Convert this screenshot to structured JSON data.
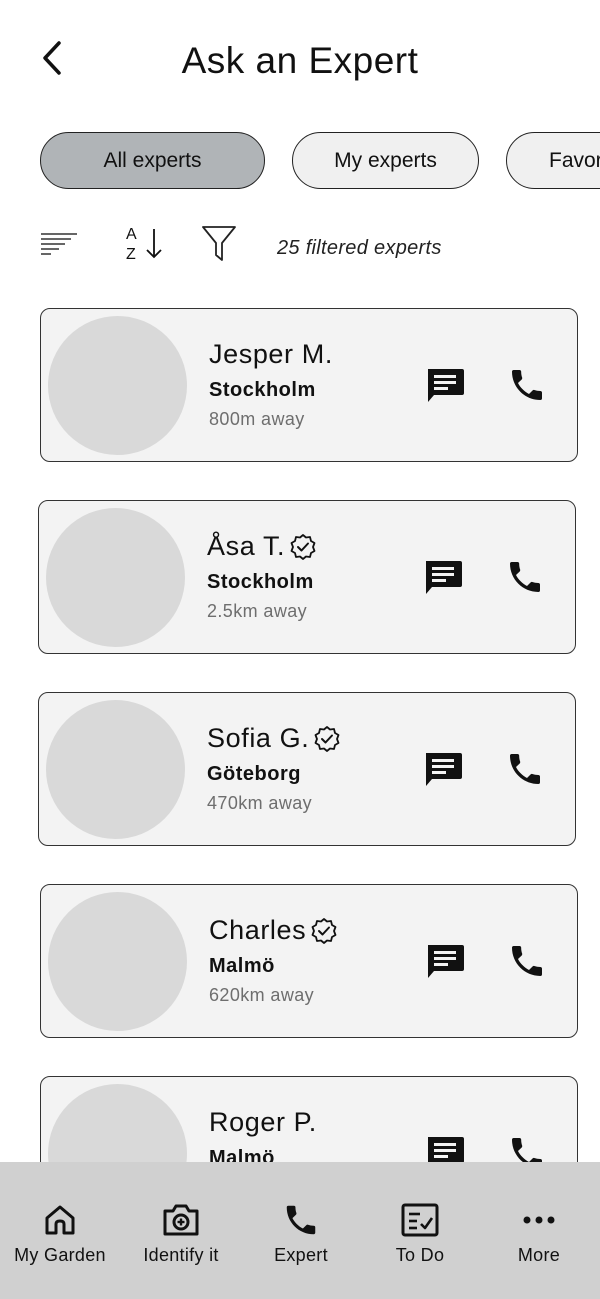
{
  "header": {
    "title": "Ask an Expert",
    "back_icon": "chevron-left-icon"
  },
  "tabs": [
    {
      "label": "All experts",
      "active": true
    },
    {
      "label": "My experts",
      "active": false
    },
    {
      "label": "Favorites",
      "active": false
    }
  ],
  "toolbar": {
    "sort_icon": "sort-lines-icon",
    "az_icon": "sort-az-icon",
    "az_top": "A",
    "az_bottom": "Z",
    "filter_icon": "funnel-icon",
    "filter_count_text": "25 filtered experts"
  },
  "experts": [
    {
      "name": "Jesper M.",
      "city": "Stockholm",
      "distance": "800m away",
      "verified": false
    },
    {
      "name": "Åsa T.",
      "city": "Stockholm",
      "distance": "2.5km away",
      "verified": true
    },
    {
      "name": "Sofia G.",
      "city": "Göteborg",
      "distance": "470km away",
      "verified": true
    },
    {
      "name": "Charles",
      "city": "Malmö",
      "distance": "620km away",
      "verified": true
    },
    {
      "name": "Roger P.",
      "city": "Malmö",
      "distance": "",
      "verified": false
    }
  ],
  "bottom_nav": [
    {
      "label": "My Garden",
      "icon": "home-icon"
    },
    {
      "label": "Identify it",
      "icon": "camera-icon"
    },
    {
      "label": "Expert",
      "icon": "phone-icon"
    },
    {
      "label": "To Do",
      "icon": "checklist-icon"
    },
    {
      "label": "More",
      "icon": "more-dots-icon"
    }
  ],
  "colors": {
    "active_tab": "#b0b4b7",
    "card_bg": "#f3f3f3",
    "avatar_placeholder": "#d9d9d9",
    "nav_bg": "#d0d0d0",
    "distance_text": "#6e6e6e"
  }
}
